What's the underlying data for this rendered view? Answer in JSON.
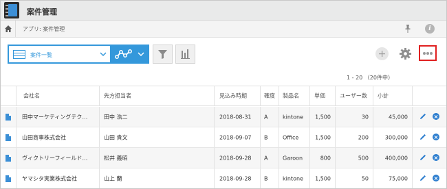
{
  "header": {
    "app_title": "案件管理"
  },
  "breadcrumb": {
    "text": "アプリ: 案件管理",
    "info_label": "i"
  },
  "toolbar": {
    "view_label": "案件一覧"
  },
  "pager": {
    "text": "1 - 20 （20件中）"
  },
  "table": {
    "columns": [
      "会社名",
      "先方担当者",
      "見込み時期",
      "確度",
      "製品名",
      "単価",
      "ユーザー数",
      "小計"
    ],
    "rows": [
      [
        "田中マーケティングテク…",
        "田中 浩二",
        "2018-08-31",
        "A",
        "kintone",
        "1,500",
        "30",
        "45,000"
      ],
      [
        "山田商事株式会社",
        "山田 貴文",
        "2018-09-07",
        "B",
        "Office",
        "1,500",
        "200",
        "300,000"
      ],
      [
        "ヴィクトリーフィールド…",
        "松井 義昭",
        "2018-09-28",
        "A",
        "Garoon",
        "800",
        "500",
        "400,000"
      ],
      [
        "ヤマシタ実業株式会社",
        "山上 蘭",
        "2018-09-28",
        "B",
        "kintone",
        "1,500",
        "50",
        "75,000"
      ]
    ]
  },
  "colors": {
    "accent": "#3498db",
    "highlight_border": "#e02020"
  },
  "icons": [
    "home-icon",
    "pin-icon",
    "info-icon",
    "list-icon",
    "graph-icon",
    "filter-icon",
    "bar-chart-icon",
    "plus-icon",
    "gear-icon",
    "more-icon",
    "document-icon",
    "pencil-icon",
    "close-circle-icon"
  ]
}
